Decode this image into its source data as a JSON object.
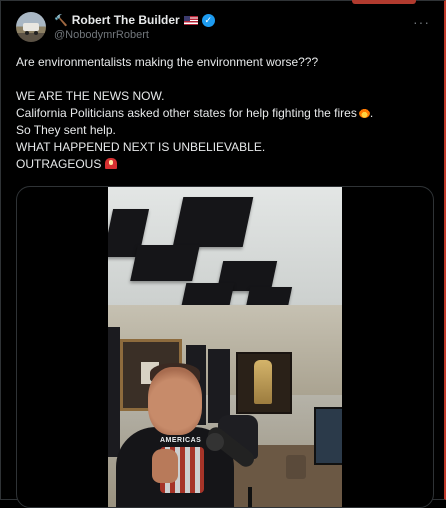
{
  "post": {
    "display_name": "Robert The Builder",
    "handle": "@NobodymrRobert",
    "more_label": "···",
    "verified_glyph": "✓",
    "hammer_glyph": "🔨",
    "line1": "Are environmentalists making the environment worse???",
    "line2": "WE ARE THE NEWS NOW.",
    "line3": "California Politicians asked other states for help fighting the fires",
    "line3_tail": ".",
    "line4": "So They sent help.",
    "line5": "WHAT HAPPENED NEXT IS UNBELIEVABLE.",
    "line6": "OUTRAGEOUS",
    "shirt_text": "AMERICAS"
  },
  "icons": {
    "avatar": "avatar-photo-truck",
    "hammer": "hammer-icon",
    "flag": "us-flag-icon",
    "verified": "verified-badge-icon",
    "more": "more-options-icon",
    "fire": "fire-emoji-icon",
    "siren": "siren-emoji-icon"
  },
  "colors": {
    "background": "#000000",
    "text": "#e7e9ea",
    "muted": "#71767b",
    "verified": "#1d9bf0",
    "border": "#2f3336"
  }
}
